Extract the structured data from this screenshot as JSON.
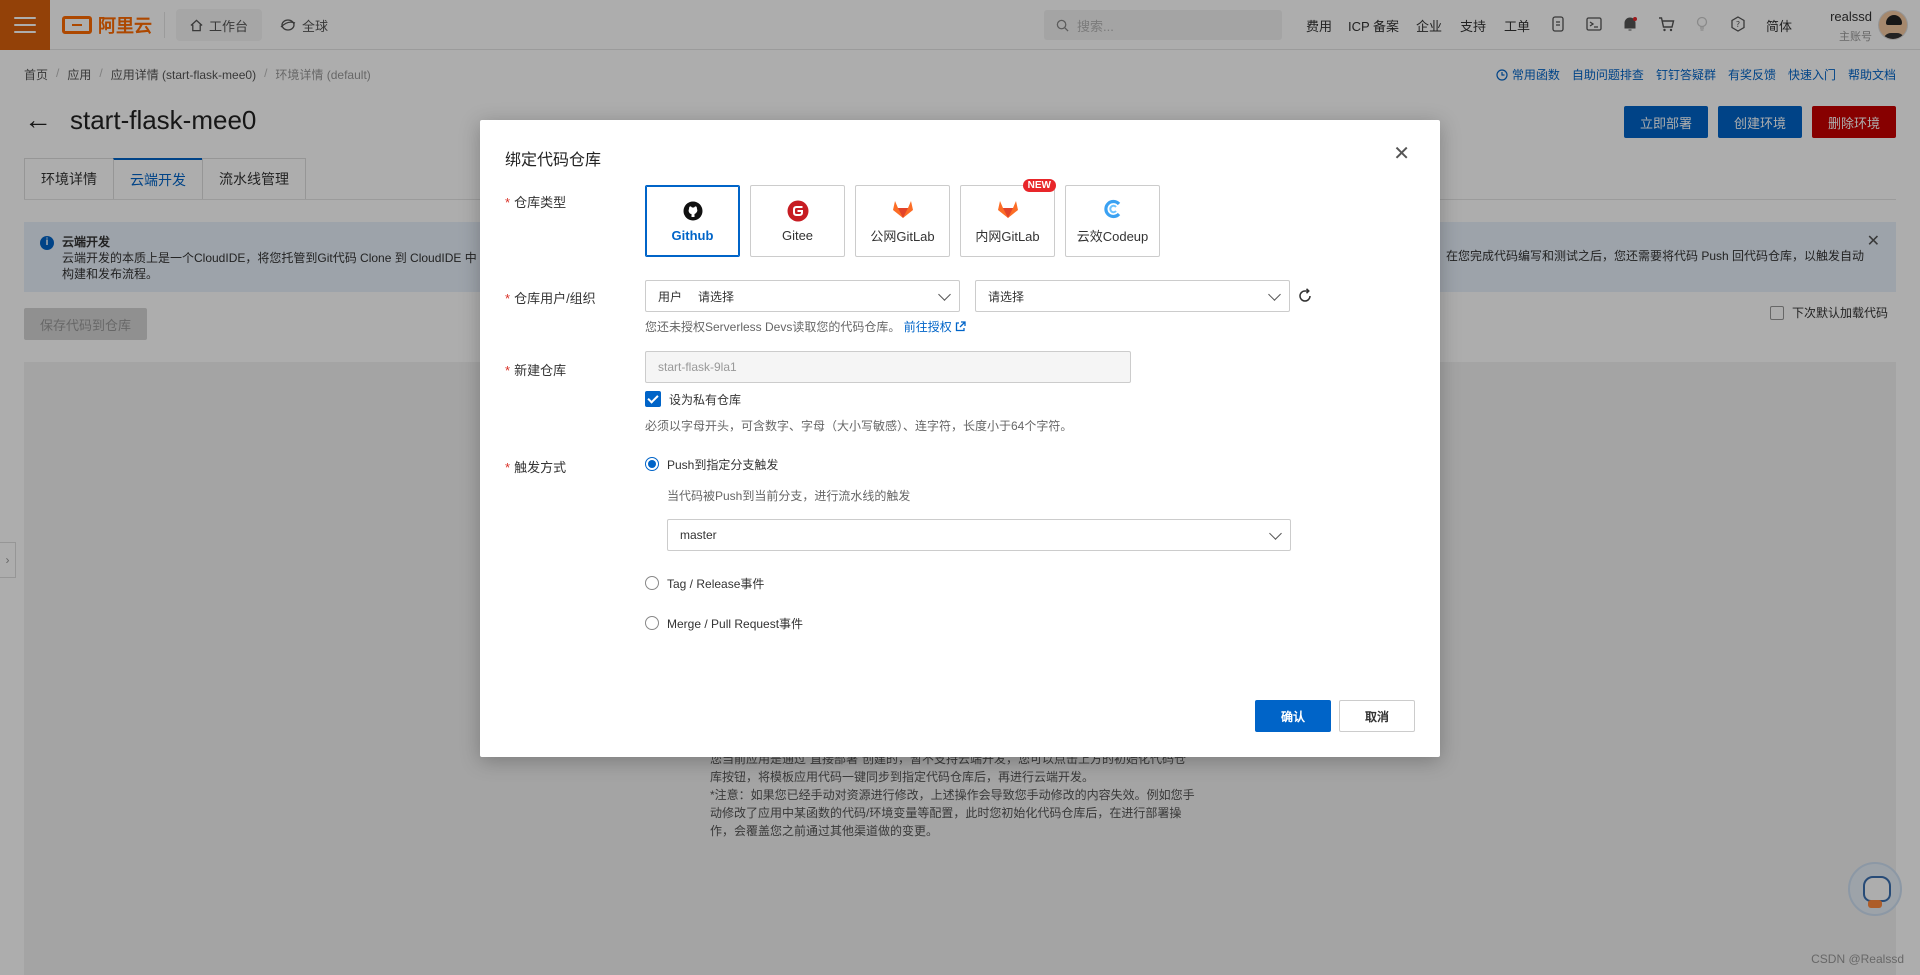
{
  "topbar": {
    "brand": "阿里云",
    "workbench": "工作台",
    "region": "全球",
    "search_placeholder": "搜索...",
    "menu": [
      "费用",
      "ICP 备案",
      "企业",
      "支持",
      "工单"
    ],
    "language": "简体",
    "user_name": "realssd",
    "user_role": "主账号"
  },
  "breadcrumb": [
    "首页",
    "应用",
    "应用详情 (start-flask-mee0)",
    "环境详情 (default)"
  ],
  "quicklinks": [
    "常用函数",
    "自助问题排查",
    "钉钉答疑群",
    "有奖反馈",
    "快速入门",
    "帮助文档"
  ],
  "page": {
    "title": "start-flask-mee0",
    "buttons": [
      "立即部署",
      "创建环境",
      "删除环境"
    ],
    "tabs": [
      "环境详情",
      "云端开发",
      "流水线管理"
    ]
  },
  "notice": {
    "title": "云端开发",
    "line1": "云端开发的本质上是一个CloudIDE，将您托管到Git代码 Clone 到 CloudIDE 中",
    "line2": "构建和发布流程。",
    "right_text": "在您完成代码编写和测试之后，您还需要将代码 Push 回代码仓库，以触发自动"
  },
  "actions": {
    "save_to_repo": "保存代码到仓库",
    "next_load": "下次默认加载代码"
  },
  "ide_text": {
    "line1": "您当前应用是通过“直接部署”创建的，暂不支持云端开发，您可以点击上方的初始化代码仓",
    "line2": "库按钮，将模板应用代码一键同步到指定代码仓库后，再进行云端开发。",
    "line3": "*注意：如果您已经手动对资源进行修改，上述操作会导致您手动修改的内容失效。例如您手",
    "line4": "动修改了应用中某函数的代码/环境变量等配置，此时您初始化代码仓库后，在进行部署操",
    "line5": "作，会覆盖您之前通过其他渠道做的变更。"
  },
  "dialog": {
    "title": "绑定代码仓库",
    "repo_type_label": "仓库类型",
    "repo_types": [
      {
        "label": "Github",
        "icon": "github-icon",
        "selected": true
      },
      {
        "label": "Gitee",
        "icon": "gitee-icon",
        "selected": false
      },
      {
        "label": "公网GitLab",
        "icon": "gitlab-icon",
        "selected": false
      },
      {
        "label": "内网GitLab",
        "icon": "gitlab-icon",
        "selected": false,
        "badge": "NEW"
      },
      {
        "label": "云效Codeup",
        "icon": "codeup-icon",
        "selected": false
      }
    ],
    "owner_label": "仓库用户/组织",
    "owner_type": "用户",
    "owner_placeholder": "请选择",
    "org_placeholder": "请选择",
    "auth_hint": "您还未授权Serverless Devs读取您的代码仓库。",
    "auth_link": "前往授权",
    "new_repo_label": "新建仓库",
    "new_repo_placeholder": "start-flask-9la1",
    "private_label": "设为私有仓库",
    "private_checked": true,
    "name_rule": "必须以字母开头，可含数字、字母（大小写敏感）、连字符，长度小于64个字符。",
    "trigger_label": "触发方式",
    "trigger_options": [
      "Push到指定分支触发",
      "Tag / Release事件",
      "Merge / Pull Request事件"
    ],
    "trigger_selected": 0,
    "push_hint": "当代码被Push到当前分支，进行流水线的触发",
    "branch": "master",
    "confirm": "确认",
    "cancel": "取消"
  },
  "watermark": "CSDN @Realssd",
  "colors": {
    "brand_orange": "#ff6a00",
    "primary_blue": "#0064c8",
    "danger_red": "#c80000",
    "required_red": "#d93026"
  }
}
